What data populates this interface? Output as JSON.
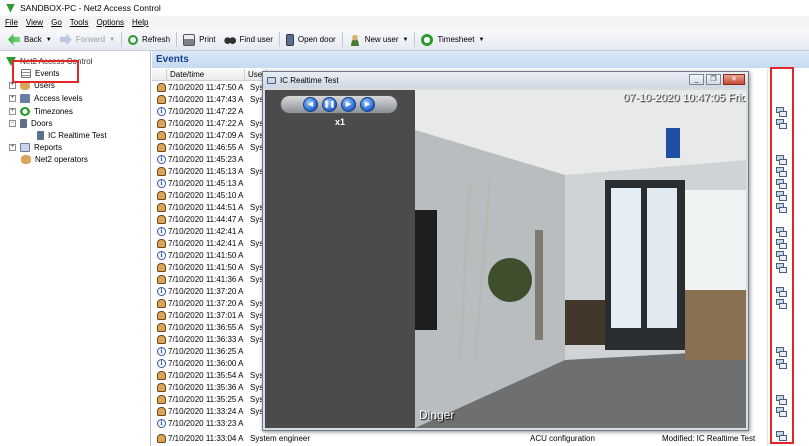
{
  "window": {
    "title": "SANDBOX-PC - Net2 Access Control"
  },
  "menu": [
    "File",
    "View",
    "Go",
    "Tools",
    "Options",
    "Help"
  ],
  "toolbar": {
    "back": "Back",
    "forward": "Forward",
    "refresh": "Refresh",
    "print": "Print",
    "find_user": "Find user",
    "open_door": "Open door",
    "new_user": "New user",
    "timesheet": "Timesheet"
  },
  "tree": {
    "root": "Net2 Access Control",
    "events": "Events",
    "users": "Users",
    "access_levels": "Access levels",
    "timezones": "Timezones",
    "doors": "Doors",
    "door_child": "IC Realtime Test",
    "reports": "Reports",
    "operators": "Net2 operators"
  },
  "events": {
    "heading": "Events",
    "col_datetime": "Date/time",
    "col_user": "User",
    "rows": [
      {
        "icon": "person-icon",
        "dt": "7/10/2020 11:47:50 A",
        "user": "Sys"
      },
      {
        "icon": "person-icon",
        "dt": "7/10/2020 11:47:43 A",
        "user": "Sys"
      },
      {
        "icon": "info-icon",
        "dt": "7/10/2020 11:47:22 A",
        "user": ""
      },
      {
        "icon": "person-icon",
        "dt": "7/10/2020 11:47:22 A",
        "user": "Sys"
      },
      {
        "icon": "person-icon",
        "dt": "7/10/2020 11:47:09 A",
        "user": "Sys"
      },
      {
        "icon": "person-icon",
        "dt": "7/10/2020 11:46:55 A",
        "user": "Sys"
      },
      {
        "icon": "info-icon",
        "dt": "7/10/2020 11:45:23 A",
        "user": ""
      },
      {
        "icon": "person-icon",
        "dt": "7/10/2020 11:45:13 A",
        "user": "Sys"
      },
      {
        "icon": "info-icon",
        "dt": "7/10/2020 11:45:13 A",
        "user": ""
      },
      {
        "icon": "person-icon",
        "dt": "7/10/2020 11:45:10 A",
        "user": ""
      },
      {
        "icon": "person-icon",
        "dt": "7/10/2020 11:44:51 A",
        "user": "Sys"
      },
      {
        "icon": "person-icon",
        "dt": "7/10/2020 11:44:47 A",
        "user": "Sys"
      },
      {
        "icon": "info-icon",
        "dt": "7/10/2020 11:42:41 A",
        "user": ""
      },
      {
        "icon": "person-icon",
        "dt": "7/10/2020 11:42:41 A",
        "user": "Sys"
      },
      {
        "icon": "info-icon",
        "dt": "7/10/2020 11:41:50 A",
        "user": ""
      },
      {
        "icon": "person-icon",
        "dt": "7/10/2020 11:41:50 A",
        "user": "Sys"
      },
      {
        "icon": "person-icon",
        "dt": "7/10/2020 11:41:36 A",
        "user": "Sys"
      },
      {
        "icon": "info-icon",
        "dt": "7/10/2020 11:37:20 A",
        "user": ""
      },
      {
        "icon": "person-icon",
        "dt": "7/10/2020 11:37:20 A",
        "user": "Sys"
      },
      {
        "icon": "person-icon",
        "dt": "7/10/2020 11:37:01 A",
        "user": "Sys"
      },
      {
        "icon": "person-icon",
        "dt": "7/10/2020 11:36:55 A",
        "user": "Sys"
      },
      {
        "icon": "person-icon",
        "dt": "7/10/2020 11:36:33 A",
        "user": "Sys"
      },
      {
        "icon": "info-icon",
        "dt": "7/10/2020 11:36:25 A",
        "user": ""
      },
      {
        "icon": "info-icon",
        "dt": "7/10/2020 11:36:00 A",
        "user": ""
      },
      {
        "icon": "person-icon",
        "dt": "7/10/2020 11:35:54 A",
        "user": "Sys"
      },
      {
        "icon": "person-icon",
        "dt": "7/10/2020 11:35:36 A",
        "user": "Sys"
      },
      {
        "icon": "person-icon",
        "dt": "7/10/2020 11:35:25 A",
        "user": "Sys"
      },
      {
        "icon": "person-icon",
        "dt": "7/10/2020 11:33:24 A",
        "user": "Sys"
      },
      {
        "icon": "info-icon",
        "dt": "7/10/2020 11:33:23 A",
        "user": ""
      }
    ],
    "last_row": {
      "dt": "7/10/2020 11:33:04 A",
      "user": "System engineer",
      "type": "ACU configuration",
      "detail": "Modified: IC Realtime Test"
    }
  },
  "video_window": {
    "title": "IC Realtime Test",
    "speed": "x1",
    "timestamp": "07-10-2020 10:47:05 Friday",
    "camera_name": "Dinger"
  },
  "colors": {
    "highlight": "#e32626",
    "header_blue": "#15428b"
  }
}
